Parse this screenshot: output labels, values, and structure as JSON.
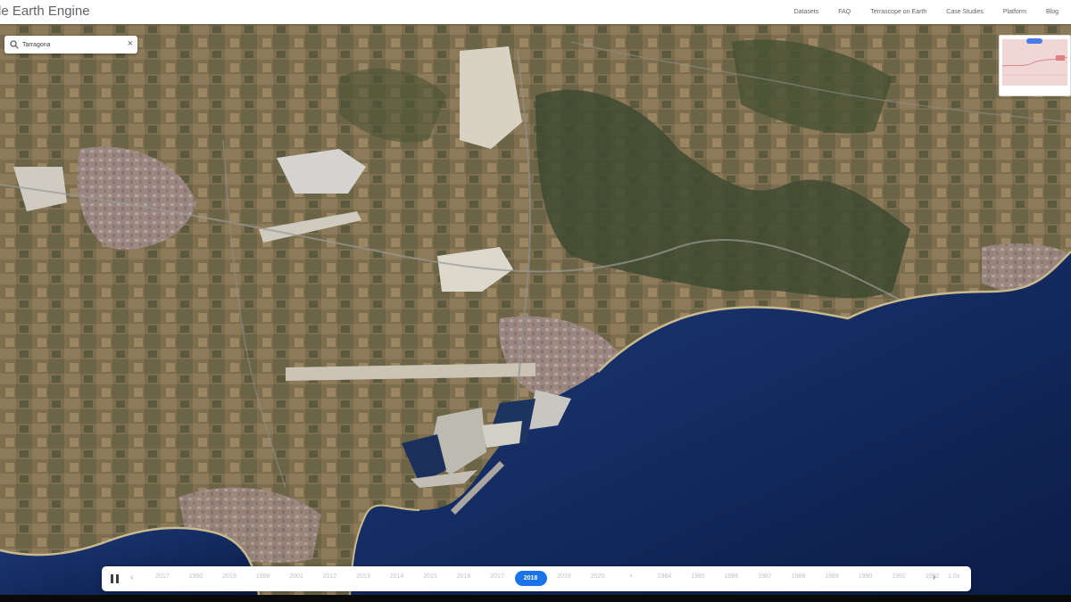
{
  "header": {
    "brand": "le Earth Engine",
    "nav": [
      "Datasets",
      "FAQ",
      "Terrascope on Earth",
      "Case Studies",
      "Platform",
      "Blog"
    ]
  },
  "search": {
    "value": "Tarragona",
    "close_glyph": "×"
  },
  "timeline": {
    "years": [
      "2017",
      "1990",
      "2019",
      "1998",
      "2001",
      "2012",
      "2013",
      "2014",
      "2015",
      "2016",
      "2017",
      "2018",
      "2019",
      "2020",
      "•",
      "1984",
      "1985",
      "1986",
      "1987",
      "1988",
      "1989",
      "1990",
      "1991",
      "1992"
    ],
    "selected": "2018",
    "next_glyph": "›",
    "prev_glyph": "‹",
    "speed": "1.0x"
  },
  "colors": {
    "accent": "#1a73e8",
    "sea": "#12285a",
    "land": "#7a6c4e"
  },
  "icons": {
    "search": "search-icon",
    "close": "close-icon",
    "pause": "pause-icon"
  }
}
